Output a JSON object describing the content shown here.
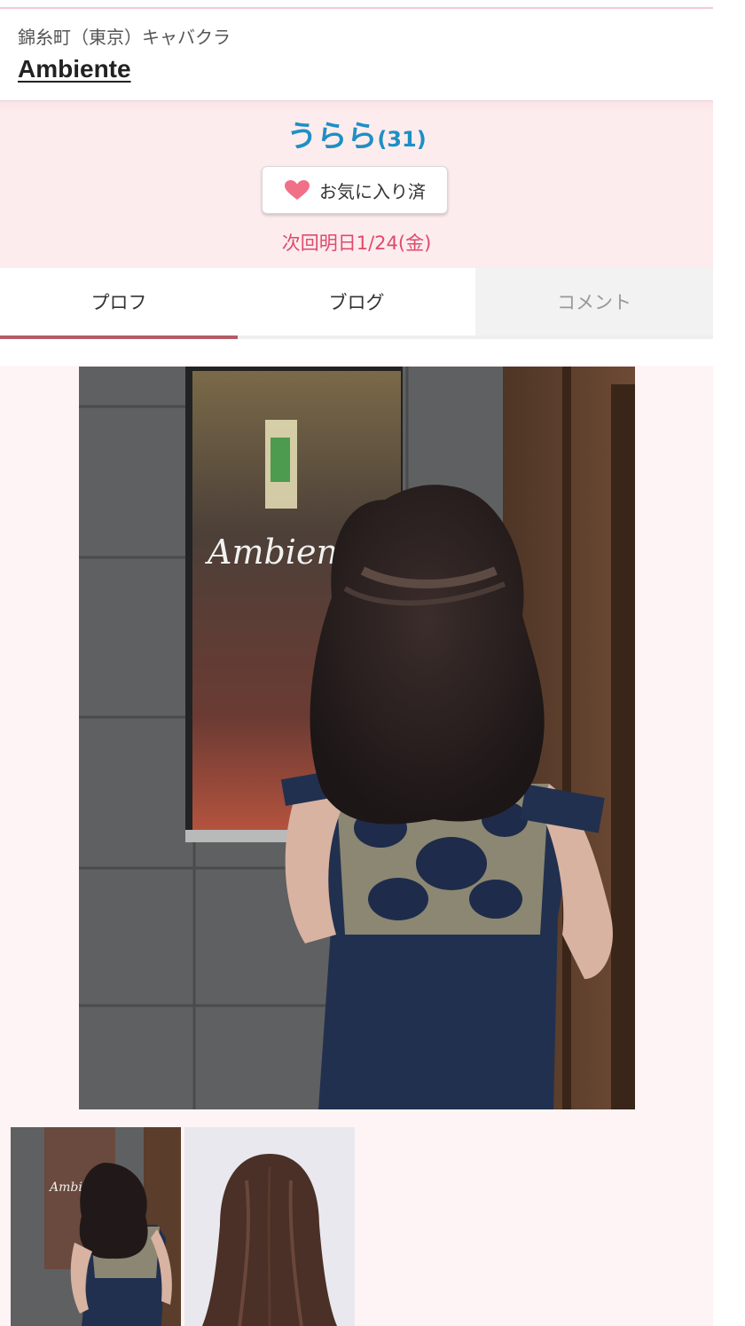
{
  "header": {
    "area": "錦糸町（東京）キャバクラ",
    "shop_name": "Ambiente"
  },
  "profile": {
    "name": "うらら",
    "age": "(31)",
    "favorite_button": {
      "label": "お気に入り済",
      "icon": "heart-icon"
    },
    "next_work": "次回明日1/24(金)"
  },
  "tabs": [
    {
      "label": "プロフ",
      "active": true
    },
    {
      "label": "ブログ",
      "active": false
    },
    {
      "label": "コメント",
      "active": false,
      "disabled": true
    }
  ],
  "photos": {
    "main_sign_text": "Ambiente",
    "thumbnails_count": 2
  },
  "colors": {
    "accent_name": "#1e8fc4",
    "next_work": "#e0496a",
    "heart": "#f07088",
    "active_tab_underline": "#b35c66",
    "profile_bg": "#fdecee"
  }
}
